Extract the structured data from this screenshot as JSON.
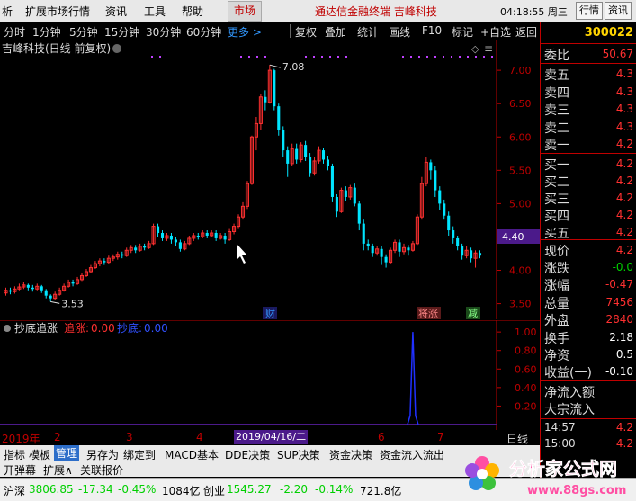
{
  "menu": {
    "items": [
      "析",
      "扩展市场行情",
      "资讯",
      "工具",
      "帮助"
    ],
    "market": "市场",
    "app_title": "通达信金融终端 吉峰科技",
    "clock": "04:18:55 周三",
    "btn_quote": "行情",
    "btn_info": "资讯"
  },
  "periods": [
    "分时",
    "1分钟",
    "5分钟",
    "15分钟",
    "30分钟",
    "60分钟"
  ],
  "period_more": "更多 >",
  "tools": [
    "复权",
    "叠加",
    "统计",
    "画线",
    "F10",
    "标记",
    "+自选",
    "返回"
  ],
  "stock": {
    "code": "300022",
    "title": "吉峰科技(日线 前复权)"
  },
  "y_ticks": [
    "7.00",
    "6.50",
    "6.00",
    "5.50",
    "5.00",
    "4.50",
    "4.00",
    "3.50"
  ],
  "price_label": "4.40",
  "annotations": {
    "high": "7.08",
    "low": "3.53",
    "cai": "财",
    "sheng": "将涨",
    "jian": "减"
  },
  "indicator": {
    "name": "抄底追涨",
    "zz_label": "追涨:",
    "zz_val": "0.00",
    "cd_label": "抄底:",
    "cd_val": "0.00",
    "y_ticks": [
      "1.00",
      "0.80",
      "0.60",
      "0.40",
      "0.20"
    ]
  },
  "dates": {
    "year": "2019年",
    "m2": "2",
    "m3": "3",
    "m4": "4",
    "sel": "2019/04/16/二",
    "m6": "6",
    "m7": "7",
    "day": "日线"
  },
  "tabs": [
    "指标",
    "模板",
    "管理",
    "另存为",
    "绑定到",
    "MACD基本",
    "DDE决策",
    "SUP决策",
    "资金决策",
    "资金流入流出"
  ],
  "bottom": [
    "开弹幕",
    "扩展∧",
    "关联报价"
  ],
  "status": {
    "sh_name": "沪深",
    "sh_val": "3806.85",
    "sh_chg": "-17.34",
    "sh_pct": "-0.45%",
    "sh_amt": "1084亿",
    "cy_name": "创业",
    "cy_val": "1545.27",
    "cy_chg": "-2.20",
    "cy_pct": "-0.14%",
    "cy_amt": "721.8亿"
  },
  "panel": {
    "code": "300022",
    "weibi_label": "委比",
    "weibi_val": "50.67",
    "sells": [
      {
        "l": "卖五",
        "v": "4.3"
      },
      {
        "l": "卖四",
        "v": "4.3"
      },
      {
        "l": "卖三",
        "v": "4.3"
      },
      {
        "l": "卖二",
        "v": "4.3"
      },
      {
        "l": "卖一",
        "v": "4.2"
      }
    ],
    "buys": [
      {
        "l": "买一",
        "v": "4.2"
      },
      {
        "l": "买二",
        "v": "4.2"
      },
      {
        "l": "买三",
        "v": "4.2"
      },
      {
        "l": "买四",
        "v": "4.2"
      },
      {
        "l": "买五",
        "v": "4.2"
      }
    ],
    "stats": [
      {
        "l": "现价",
        "v": "4.2"
      },
      {
        "l": "涨跌",
        "v": "-0.0"
      },
      {
        "l": "涨幅",
        "v": "-0.47"
      },
      {
        "l": "总量",
        "v": "7456"
      },
      {
        "l": "外盘",
        "v": "2840"
      }
    ],
    "stats2": [
      {
        "l": "换手",
        "v": "2.18"
      },
      {
        "l": "净资",
        "v": "0.5"
      },
      {
        "l": "收益(一)",
        "v": "-0.10"
      }
    ],
    "flow1": "净流入额",
    "flow2": "大宗流入",
    "ticks": [
      {
        "t": "14:57",
        "v": "4.2"
      },
      {
        "t": "15:00",
        "v": "4.2"
      }
    ]
  },
  "watermark": {
    "text": "分析家公式网",
    "url": "www.88gs.com"
  },
  "chart_data": {
    "type": "candlestick",
    "ylim": [
      3.4,
      7.15
    ],
    "indicator_ylim": [
      0,
      1.05
    ],
    "candles": [
      [
        3.66,
        3.7,
        3.62,
        3.74
      ],
      [
        3.7,
        3.68,
        3.64,
        3.74
      ],
      [
        3.68,
        3.72,
        3.65,
        3.76
      ],
      [
        3.72,
        3.75,
        3.7,
        3.8
      ],
      [
        3.75,
        3.78,
        3.72,
        3.82
      ],
      [
        3.78,
        3.74,
        3.7,
        3.8
      ],
      [
        3.74,
        3.72,
        3.68,
        3.78
      ],
      [
        3.72,
        3.76,
        3.7,
        3.8
      ],
      [
        3.76,
        3.7,
        3.66,
        3.78
      ],
      [
        3.7,
        3.62,
        3.58,
        3.72
      ],
      [
        3.62,
        3.58,
        3.53,
        3.64
      ],
      [
        3.58,
        3.64,
        3.56,
        3.68
      ],
      [
        3.64,
        3.7,
        3.62,
        3.74
      ],
      [
        3.7,
        3.76,
        3.68,
        3.8
      ],
      [
        3.76,
        3.82,
        3.74,
        3.86
      ],
      [
        3.82,
        3.8,
        3.76,
        3.86
      ],
      [
        3.8,
        3.86,
        3.78,
        3.9
      ],
      [
        3.86,
        3.92,
        3.84,
        3.96
      ],
      [
        3.92,
        3.98,
        3.9,
        4.02
      ],
      [
        3.98,
        4.04,
        3.96,
        4.08
      ],
      [
        4.04,
        4.1,
        4.02,
        4.14
      ],
      [
        4.1,
        4.14,
        4.06,
        4.18
      ],
      [
        4.14,
        4.12,
        4.08,
        4.18
      ],
      [
        4.12,
        4.18,
        4.1,
        4.22
      ],
      [
        4.18,
        4.2,
        4.14,
        4.24
      ],
      [
        4.2,
        4.24,
        4.16,
        4.28
      ],
      [
        4.24,
        4.22,
        4.18,
        4.28
      ],
      [
        4.22,
        4.3,
        4.2,
        4.34
      ],
      [
        4.3,
        4.34,
        4.26,
        4.38
      ],
      [
        4.34,
        4.3,
        4.26,
        4.38
      ],
      [
        4.3,
        4.36,
        4.28,
        4.4
      ],
      [
        4.36,
        4.34,
        4.3,
        4.4
      ],
      [
        4.34,
        4.4,
        4.32,
        4.44
      ],
      [
        4.4,
        4.66,
        4.38,
        4.7
      ],
      [
        4.66,
        4.56,
        4.5,
        4.7
      ],
      [
        4.56,
        4.48,
        4.44,
        4.6
      ],
      [
        4.48,
        4.52,
        4.44,
        4.56
      ],
      [
        4.52,
        4.46,
        4.4,
        4.56
      ],
      [
        4.46,
        4.42,
        4.36,
        4.5
      ],
      [
        4.42,
        4.32,
        4.28,
        4.46
      ],
      [
        4.32,
        4.4,
        4.3,
        4.44
      ],
      [
        4.4,
        4.48,
        4.38,
        4.52
      ],
      [
        4.48,
        4.52,
        4.44,
        4.56
      ],
      [
        4.52,
        4.5,
        4.46,
        4.56
      ],
      [
        4.5,
        4.56,
        4.48,
        4.6
      ],
      [
        4.56,
        4.52,
        4.48,
        4.6
      ],
      [
        4.52,
        4.56,
        4.5,
        4.6
      ],
      [
        4.56,
        4.48,
        4.44,
        4.6
      ],
      [
        4.48,
        4.52,
        4.46,
        4.56
      ],
      [
        4.52,
        4.46,
        4.4,
        4.56
      ],
      [
        4.46,
        4.58,
        4.44,
        4.62
      ],
      [
        4.58,
        4.66,
        4.54,
        4.7
      ],
      [
        4.66,
        4.8,
        4.62,
        4.84
      ],
      [
        4.8,
        4.96,
        4.76,
        5.02
      ],
      [
        4.96,
        5.3,
        4.92,
        5.34
      ],
      [
        5.3,
        6.0,
        5.28,
        6.02
      ],
      [
        6.0,
        6.2,
        5.8,
        6.3
      ],
      [
        6.2,
        6.6,
        6.1,
        6.64
      ],
      [
        6.6,
        6.52,
        6.4,
        6.7
      ],
      [
        6.52,
        7.0,
        6.5,
        7.08
      ],
      [
        7.0,
        6.46,
        6.4,
        7.02
      ],
      [
        6.46,
        6.1,
        6.02,
        6.5
      ],
      [
        6.1,
        5.8,
        5.7,
        6.16
      ],
      [
        5.8,
        5.6,
        5.4,
        5.86
      ],
      [
        5.6,
        5.82,
        5.56,
        5.9
      ],
      [
        5.82,
        5.66,
        5.6,
        5.9
      ],
      [
        5.66,
        5.88,
        5.62,
        5.92
      ],
      [
        5.88,
        5.7,
        5.64,
        5.94
      ],
      [
        5.7,
        5.46,
        5.4,
        5.76
      ],
      [
        5.46,
        5.64,
        5.42,
        5.7
      ],
      [
        5.64,
        5.8,
        5.6,
        5.86
      ],
      [
        5.8,
        5.66,
        5.6,
        5.84
      ],
      [
        5.66,
        5.56,
        5.5,
        5.72
      ],
      [
        5.56,
        5.1,
        5.02,
        5.6
      ],
      [
        5.1,
        4.88,
        4.8,
        5.14
      ],
      [
        4.88,
        5.2,
        4.86,
        5.24
      ],
      [
        5.2,
        5.1,
        5.04,
        5.26
      ],
      [
        5.1,
        5.24,
        5.06,
        5.28
      ],
      [
        5.24,
        5.0,
        4.96,
        5.3
      ],
      [
        5.0,
        4.7,
        4.6,
        5.04
      ],
      [
        4.7,
        4.4,
        4.3,
        4.76
      ],
      [
        4.4,
        4.36,
        4.3,
        4.46
      ],
      [
        4.36,
        4.26,
        4.2,
        4.4
      ],
      [
        4.26,
        4.32,
        4.22,
        4.36
      ],
      [
        4.32,
        4.2,
        4.08,
        4.36
      ],
      [
        4.2,
        4.12,
        4.04,
        4.24
      ],
      [
        4.12,
        4.3,
        4.1,
        4.34
      ],
      [
        4.3,
        4.42,
        4.26,
        4.46
      ],
      [
        4.42,
        4.28,
        4.2,
        4.46
      ],
      [
        4.28,
        4.34,
        4.24,
        4.4
      ],
      [
        4.34,
        4.3,
        4.22,
        4.38
      ],
      [
        4.3,
        4.4,
        4.28,
        4.44
      ],
      [
        4.4,
        4.8,
        4.38,
        4.84
      ],
      [
        4.8,
        5.3,
        4.76,
        5.4
      ],
      [
        5.3,
        5.62,
        5.26,
        5.7
      ],
      [
        5.62,
        5.5,
        5.36,
        5.66
      ],
      [
        5.5,
        5.2,
        5.1,
        5.56
      ],
      [
        5.2,
        5.0,
        4.9,
        5.26
      ],
      [
        5.0,
        4.82,
        4.76,
        5.06
      ],
      [
        4.82,
        4.6,
        4.52,
        4.88
      ],
      [
        4.6,
        4.48,
        4.4,
        4.66
      ],
      [
        4.48,
        4.36,
        4.3,
        4.52
      ],
      [
        4.36,
        4.22,
        4.16,
        4.4
      ],
      [
        4.22,
        4.3,
        4.18,
        4.36
      ],
      [
        4.3,
        4.18,
        4.12,
        4.34
      ],
      [
        4.18,
        4.26,
        4.04,
        4.3
      ],
      [
        4.26,
        4.22,
        4.18,
        4.3
      ]
    ],
    "spike": {
      "candle_index": 91,
      "value": 1.0
    }
  }
}
